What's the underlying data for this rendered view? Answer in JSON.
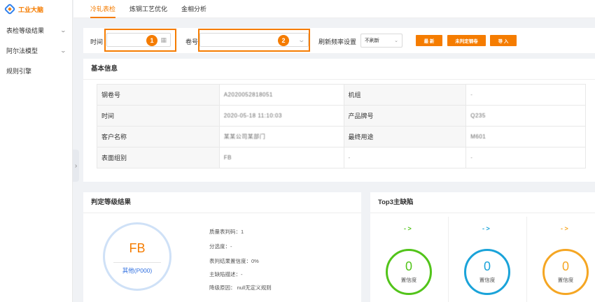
{
  "app": {
    "logo_text": "工业大脑"
  },
  "sidebar": {
    "items": [
      {
        "label": "表检等级结果",
        "has_chevron": true
      },
      {
        "label": "阿尔法模型",
        "has_chevron": true
      },
      {
        "label": "规则引擎",
        "has_chevron": false
      }
    ]
  },
  "tabs": [
    {
      "label": "冷轧表检",
      "active": true
    },
    {
      "label": "炼钢工艺优化",
      "active": false
    },
    {
      "label": "金相分析",
      "active": false
    }
  ],
  "filter": {
    "time_label": "时间",
    "coil_label": "卷号",
    "refresh_label": "刷新频率设置",
    "refresh_value": "不刷新",
    "badge_1": "1",
    "badge_2": "2",
    "buttons": {
      "latest": "最 新",
      "unjudged": "未判定钢卷",
      "import": "导 入"
    }
  },
  "basic_info": {
    "title": "基本信息",
    "rows": [
      {
        "k1": "钢卷号",
        "v1": "A2020052818051",
        "k2": "机组",
        "v2": "-"
      },
      {
        "k1": "时间",
        "v1": "2020-05-18 11:10:03",
        "k2": "产品牌号",
        "v2": "Q235"
      },
      {
        "k1": "客户名称",
        "v1": "某某公司某部门",
        "k2": "最终用途",
        "v2": "M601"
      },
      {
        "k1": "表面组别",
        "v1": "FB",
        "k2": "-",
        "v2": "-"
      }
    ]
  },
  "judgement": {
    "title": "判定等级结果",
    "grade": "FB",
    "grade_sub": "其他(P000)",
    "lines": [
      "质量表判码：1",
      "分选度：-",
      "表判结果置信度：0%",
      "主缺陷描述：-",
      "降级原因：  null无定义规则"
    ]
  },
  "top3": {
    "title": "Top3主缺陷",
    "items": [
      {
        "arrow": "- >",
        "value": "0",
        "caption": "置信度",
        "color": "#52c41a"
      },
      {
        "arrow": "- >",
        "value": "0",
        "caption": "置信度",
        "color": "#1aa3d9"
      },
      {
        "arrow": "- >",
        "value": "0",
        "caption": "置信度",
        "color": "#f5a623"
      }
    ]
  }
}
